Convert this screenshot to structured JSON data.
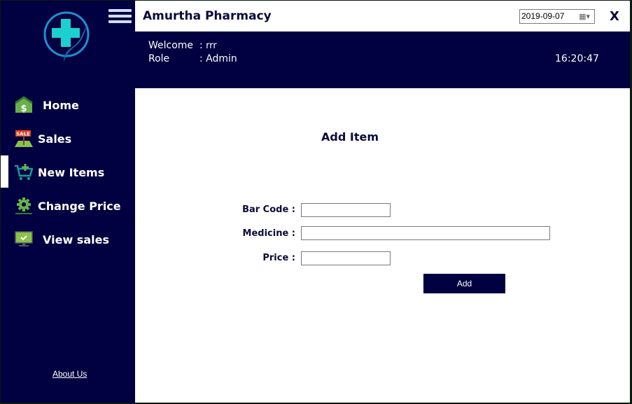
{
  "app": {
    "title": "Amurtha Pharmacy",
    "date": "2019-09-07",
    "close_label": "X",
    "time": "16:20:47"
  },
  "user": {
    "welcome_label": "Welcome",
    "welcome_value": "rrr",
    "role_label": "Role",
    "role_value": "Admin",
    "sep": ":"
  },
  "sidebar": {
    "items": [
      {
        "label": "Home",
        "icon": "home-dollar-icon"
      },
      {
        "label": "Sales",
        "icon": "sale-sign-icon"
      },
      {
        "label": "New Items",
        "icon": "cart-add-icon",
        "active": true
      },
      {
        "label": "Change Price",
        "icon": "gear-icon"
      },
      {
        "label": "View sales",
        "icon": "monitor-check-icon"
      }
    ],
    "about": "About Us"
  },
  "form": {
    "heading": "Add Item",
    "barcode_label": "Bar Code :",
    "barcode_value": "",
    "medicine_label": "Medicine :",
    "medicine_value": "",
    "price_label": "Price :",
    "price_value": "",
    "add_label": "Add"
  },
  "colors": {
    "navy": "#010040",
    "accent_green": "#6ab04c"
  }
}
